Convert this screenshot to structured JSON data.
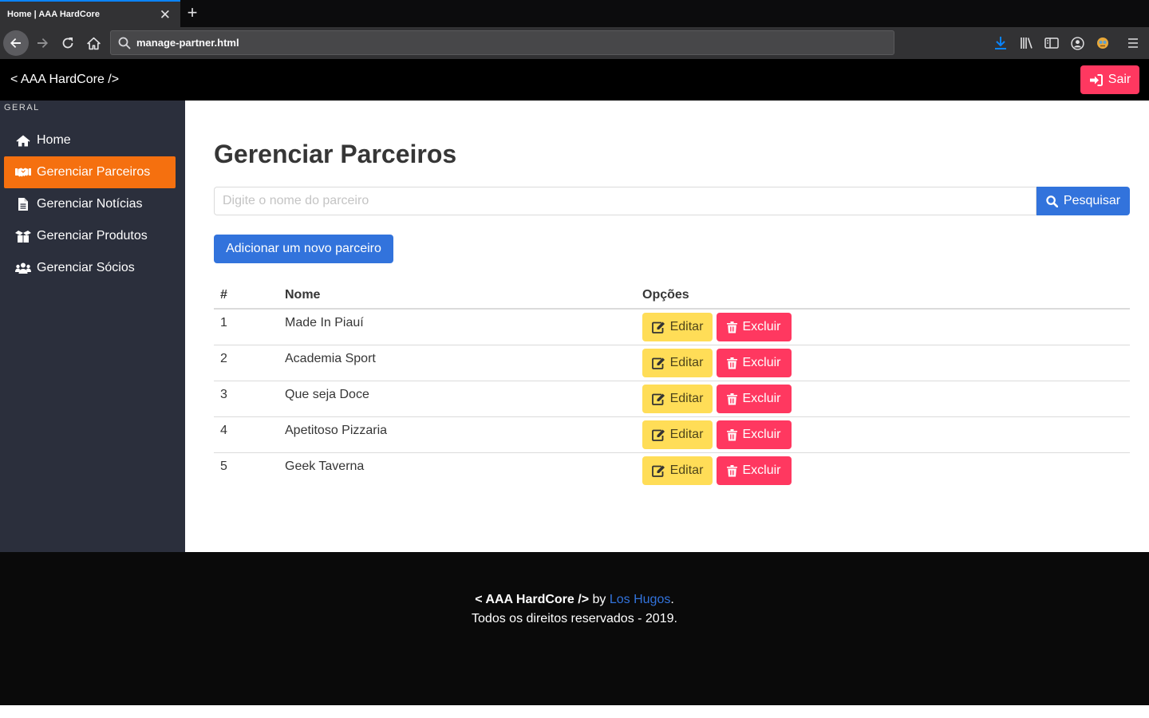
{
  "browser": {
    "tab_title": "Home | AAA HardCore",
    "tab_close": "✕",
    "new_tab": "+",
    "url": "manage-partner.html"
  },
  "header": {
    "brand": "< AAA HardCore />",
    "logout_label": "Sair"
  },
  "sidebar": {
    "section_label": "GERAL",
    "items": [
      {
        "label": "Home",
        "icon": "home-icon",
        "active": false
      },
      {
        "label": "Gerenciar Parceiros",
        "icon": "handshake-icon",
        "active": true
      },
      {
        "label": "Gerenciar Notícias",
        "icon": "file-icon",
        "active": false
      },
      {
        "label": "Gerenciar Produtos",
        "icon": "box-open-icon",
        "active": false
      },
      {
        "label": "Gerenciar Sócios",
        "icon": "users-icon",
        "active": false
      }
    ]
  },
  "main": {
    "title": "Gerenciar Parceiros",
    "search_placeholder": "Digite o nome do parceiro",
    "search_label": "Pesquisar",
    "add_label": "Adicionar um novo parceiro",
    "table": {
      "headers": [
        "#",
        "Nome",
        "Opções"
      ],
      "rows": [
        {
          "num": "1",
          "name": "Made In Piauí"
        },
        {
          "num": "2",
          "name": "Academia Sport"
        },
        {
          "num": "3",
          "name": "Que seja Doce"
        },
        {
          "num": "4",
          "name": "Apetitoso Pizzaria"
        },
        {
          "num": "5",
          "name": "Geek Taverna"
        }
      ],
      "edit_label": "Editar",
      "delete_label": "Excluir"
    }
  },
  "footer": {
    "brand": "< AAA HardCore />",
    "by": " by ",
    "author": "Los Hugos",
    "period": ".",
    "rights": "Todos os direitos reservados - 2019."
  },
  "colors": {
    "primary": "#3273dc",
    "danger": "#ff3860",
    "warning": "#ffdd57",
    "active_menu": "#f5700f",
    "sidebar_bg": "#2b2f3c"
  }
}
